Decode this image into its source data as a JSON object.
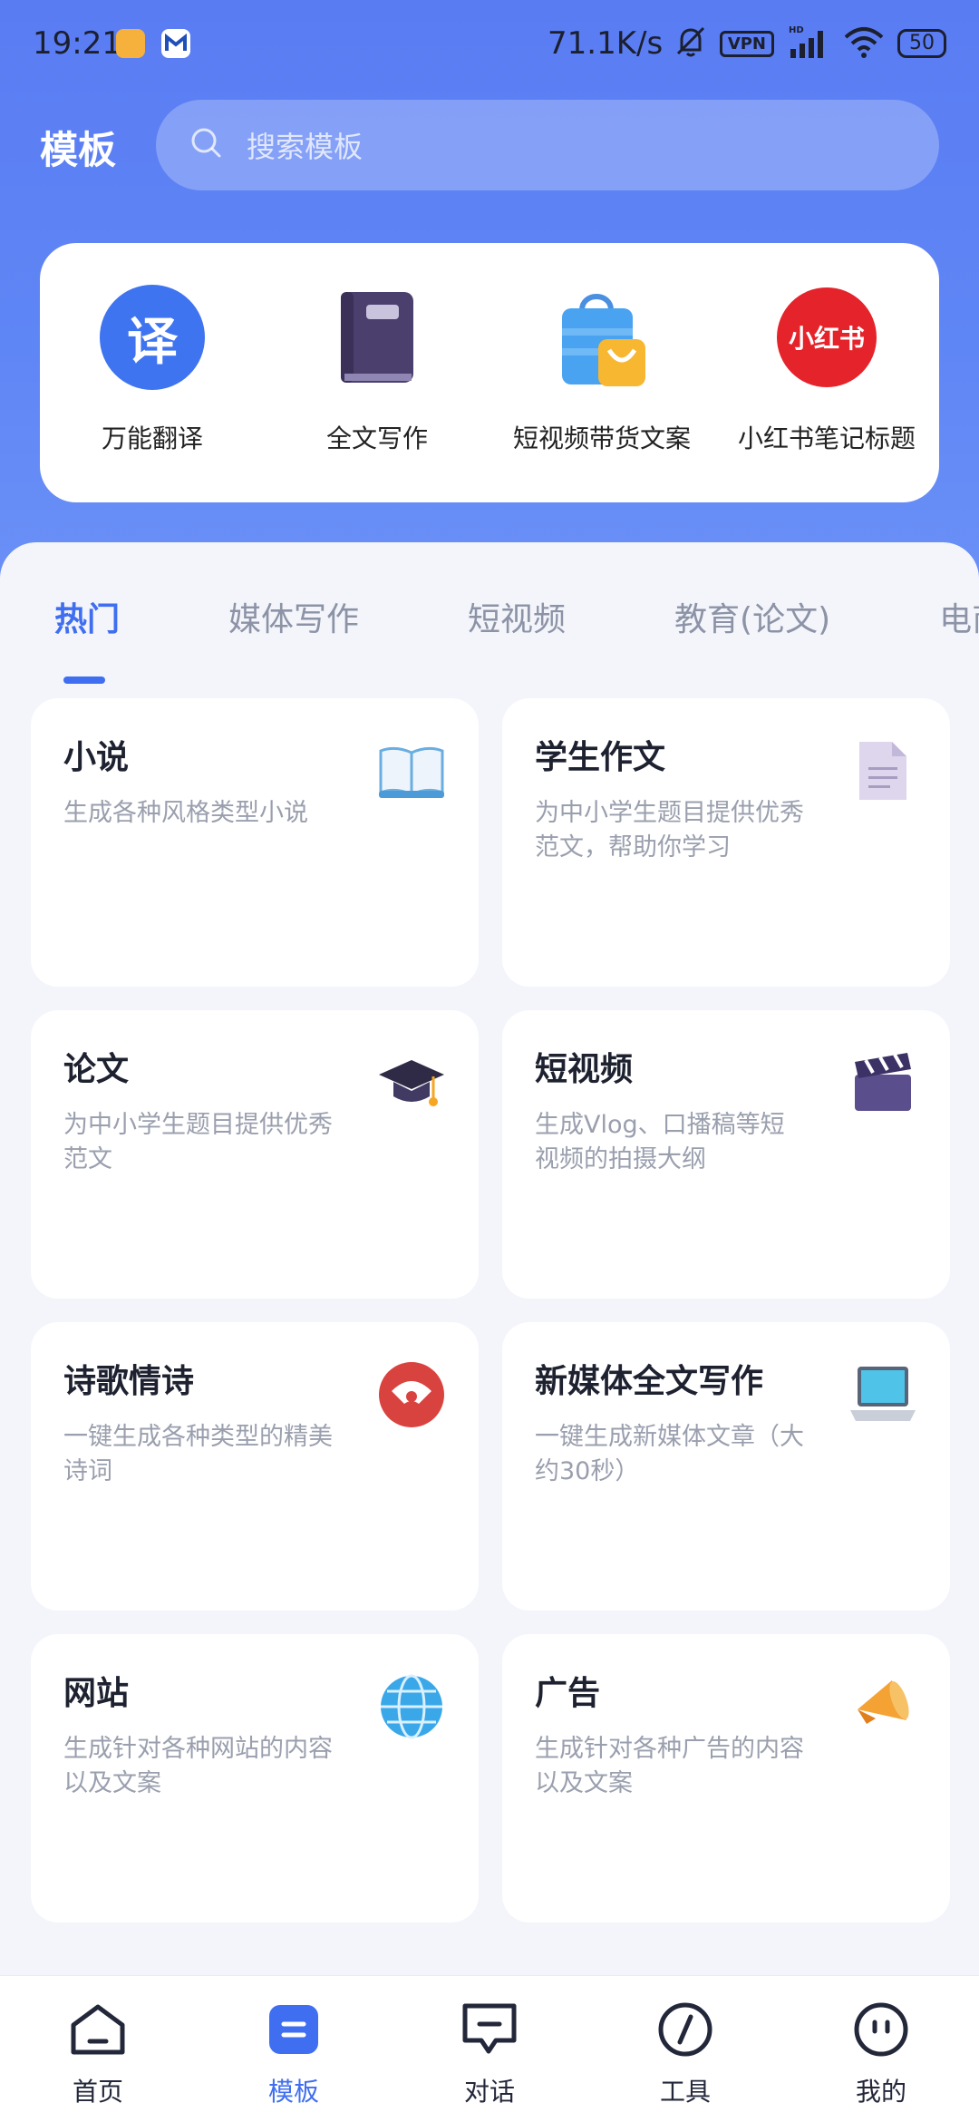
{
  "status_bar": {
    "time": "19:21",
    "network_speed": "71.1K/s",
    "vpn": "VPN",
    "signal": "HD",
    "battery": "50"
  },
  "header": {
    "title": "模板",
    "search_placeholder": "搜索模板"
  },
  "quick_tools": [
    {
      "label": "万能翻译",
      "icon": "translate-icon",
      "glyph": "译"
    },
    {
      "label": "全文写作",
      "icon": "notebook-icon"
    },
    {
      "label": "短视频带货文案",
      "icon": "shopping-bag-icon"
    },
    {
      "label": "小红书笔记标题",
      "icon": "xiaohongshu-icon",
      "glyph": "小红书"
    }
  ],
  "tabs": [
    {
      "label": "热门",
      "active": true
    },
    {
      "label": "媒体写作"
    },
    {
      "label": "短视频"
    },
    {
      "label": "教育(论文)"
    },
    {
      "label": "电商"
    }
  ],
  "cards": [
    {
      "title": "小说",
      "desc": "生成各种风格类型小说",
      "icon": "open-book-icon"
    },
    {
      "title": "学生作文",
      "desc": "为中小学生题目提供优秀范文，帮助你学习",
      "icon": "document-icon"
    },
    {
      "title": "论文",
      "desc": "为中小学生题目提供优秀范文",
      "icon": "graduation-cap-icon"
    },
    {
      "title": "短视频",
      "desc": "生成Vlog、口播稿等短视频的拍摄大纲",
      "icon": "clapperboard-icon"
    },
    {
      "title": "诗歌情诗",
      "desc": "一键生成各种类型的精美诗词",
      "icon": "fan-icon"
    },
    {
      "title": "新媒体全文写作",
      "desc": "一键生成新媒体文章（大约30秒）",
      "icon": "laptop-icon"
    },
    {
      "title": "网站",
      "desc": "生成针对各种网站的内容以及文案",
      "icon": "globe-icon"
    },
    {
      "title": "广告",
      "desc": "生成针对各种广告的内容以及文案",
      "icon": "megaphone-icon"
    }
  ],
  "bottom_nav": [
    {
      "label": "首页",
      "icon": "home-icon"
    },
    {
      "label": "模板",
      "icon": "template-icon",
      "active": true
    },
    {
      "label": "对话",
      "icon": "chat-icon"
    },
    {
      "label": "工具",
      "icon": "tools-icon"
    },
    {
      "label": "我的",
      "icon": "profile-icon"
    }
  ],
  "colors": {
    "accent": "#3f6ef0",
    "header_bg": "#5a7cf3"
  }
}
